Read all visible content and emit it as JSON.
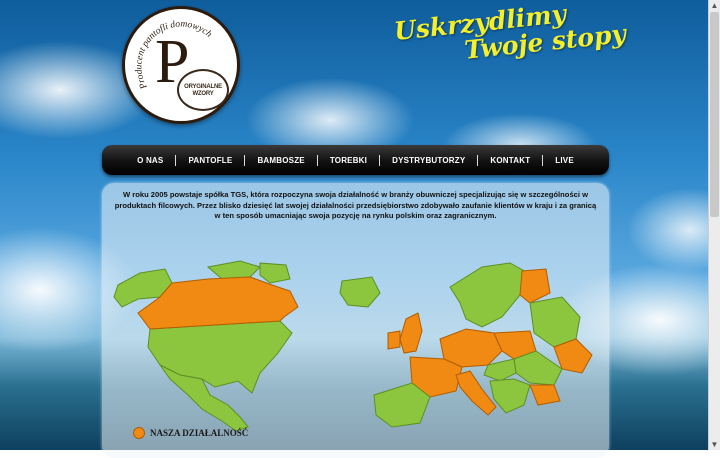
{
  "logo": {
    "arc_text": "Producent pantofli domowych",
    "monogram": "P",
    "seal_lines": [
      "ORYGINALNE",
      "WZORY"
    ]
  },
  "slogan": {
    "line1": "Uskrzydlimy",
    "line2": "Twoje stopy",
    "color": "#f3ef2c"
  },
  "nav": {
    "items": [
      {
        "label": "O NAS"
      },
      {
        "label": "PANTOFLE"
      },
      {
        "label": "BAMBOSZE"
      },
      {
        "label": "TOREBKI"
      },
      {
        "label": "DYSTRYBUTORZY"
      },
      {
        "label": "KONTAKT"
      },
      {
        "label": "LIVE"
      }
    ]
  },
  "intro": {
    "text": "W roku 2005 powstaje spółka TGS, która rozpoczyna swoja działalność w branży obuwniczej specjalizując się w szczególności w produktach filcowych. Przez blisko dziesięć lat swojej działalności przedsiębiorstwo zdobywało zaufanie klientów w kraju i za granicą w ten sposób umacniając swoja pozycję na rynku polskim oraz zagranicznym."
  },
  "legend": {
    "label": "NASZA DZIAŁALNOŚĆ",
    "color": "#f08a12"
  },
  "map_colors": {
    "active": "#f08a12",
    "inactive": "#8cc63f"
  }
}
